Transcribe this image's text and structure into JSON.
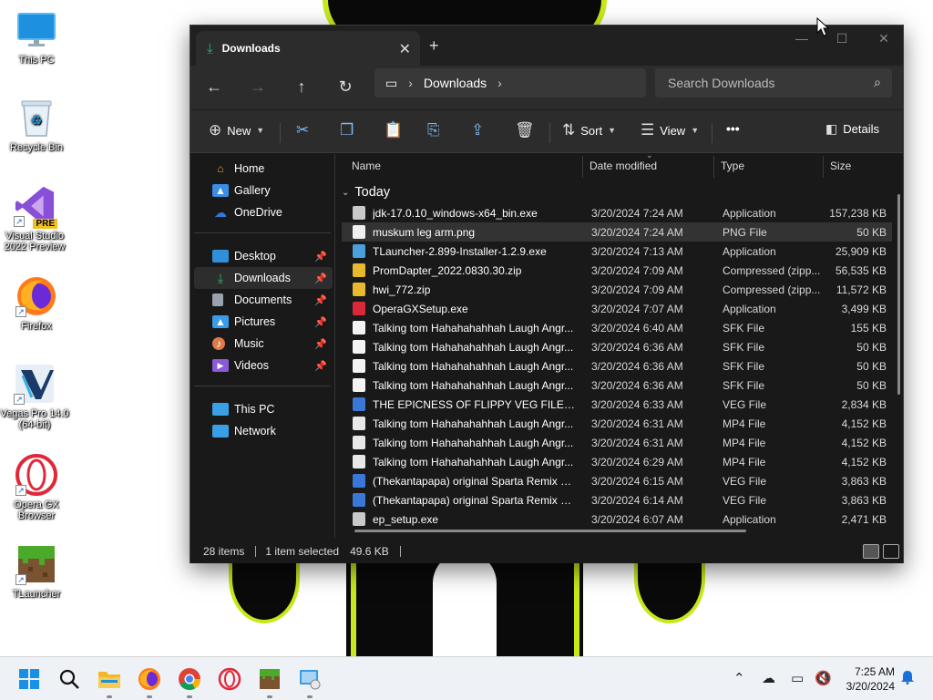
{
  "desktop": {
    "icons": [
      {
        "label": "This PC",
        "icon": "monitor-icon"
      },
      {
        "label": "Recycle Bin",
        "icon": "recycle-bin-icon"
      },
      {
        "label": "Visual Studio 2022 Preview",
        "icon": "visual-studio-icon",
        "badge": "PRE"
      },
      {
        "label": "Firefox",
        "icon": "firefox-icon"
      },
      {
        "label": "Vegas Pro 14.0 (64-bit)",
        "icon": "vegas-pro-icon"
      },
      {
        "label": "Opera GX Browser",
        "icon": "opera-gx-icon"
      },
      {
        "label": "TLauncher",
        "icon": "minecraft-block-icon"
      }
    ]
  },
  "window": {
    "tab_title": "Downloads",
    "new_tab": "+",
    "nav": {
      "address_root": "Downloads",
      "search_placeholder": "Search Downloads"
    },
    "toolbar": {
      "new_label": "New",
      "sort_label": "Sort",
      "view_label": "View",
      "more_label": "•••",
      "details_label": "Details"
    },
    "sidebar": {
      "items": [
        {
          "label": "Home",
          "color": "#e2a63a"
        },
        {
          "label": "Gallery",
          "color": "#3a8ee6"
        },
        {
          "label": "OneDrive",
          "color": "#2f7ad8"
        },
        {
          "label": "Desktop",
          "color": "#2f8fd8",
          "pinned": true
        },
        {
          "label": "Downloads",
          "color": "#2bb673",
          "pinned": true,
          "active": true
        },
        {
          "label": "Documents",
          "color": "#9aa3ad",
          "pinned": true
        },
        {
          "label": "Pictures",
          "color": "#3a9be6",
          "pinned": true
        },
        {
          "label": "Music",
          "color": "#e07a4a",
          "pinned": true
        },
        {
          "label": "Videos",
          "color": "#8a5ad8",
          "pinned": true
        },
        {
          "label": "This PC",
          "color": "#3aa0e6"
        },
        {
          "label": "Network",
          "color": "#3aa0e6"
        }
      ]
    },
    "columns": {
      "name": "Name",
      "date": "Date modified",
      "type": "Type",
      "size": "Size"
    },
    "group": "Today",
    "files": [
      {
        "name": "jdk-17.0.10_windows-x64_bin.exe",
        "date": "3/20/2024 7:24 AM",
        "type": "Application",
        "size": "157,238 KB",
        "icon_color": "#c9c9c9"
      },
      {
        "name": "muskum leg arm.png",
        "date": "3/20/2024 7:24 AM",
        "type": "PNG File",
        "size": "50 KB",
        "icon_color": "#f0f0f0",
        "selected": true
      },
      {
        "name": "TLauncher-2.899-Installer-1.2.9.exe",
        "date": "3/20/2024 7:13 AM",
        "type": "Application",
        "size": "25,909 KB",
        "icon_color": "#4aa0d8"
      },
      {
        "name": "PromDapter_2022.0830.30.zip",
        "date": "3/20/2024 7:09 AM",
        "type": "Compressed (zipp...",
        "size": "56,535 KB",
        "icon_color": "#e8b830"
      },
      {
        "name": "hwi_772.zip",
        "date": "3/20/2024 7:09 AM",
        "type": "Compressed (zipp...",
        "size": "11,572 KB",
        "icon_color": "#e8b830"
      },
      {
        "name": "OperaGXSetup.exe",
        "date": "3/20/2024 7:07 AM",
        "type": "Application",
        "size": "3,499 KB",
        "icon_color": "#d8283a"
      },
      {
        "name": "Talking tom Hahahahahhah Laugh Angr...",
        "date": "3/20/2024 6:40 AM",
        "type": "SFK File",
        "size": "155 KB",
        "icon_color": "#f4f4f4"
      },
      {
        "name": "Talking tom Hahahahahhah Laugh Angr...",
        "date": "3/20/2024 6:36 AM",
        "type": "SFK File",
        "size": "50 KB",
        "icon_color": "#f4f4f4"
      },
      {
        "name": "Talking tom Hahahahahhah Laugh Angr...",
        "date": "3/20/2024 6:36 AM",
        "type": "SFK File",
        "size": "50 KB",
        "icon_color": "#f4f4f4"
      },
      {
        "name": "Talking tom Hahahahahhah Laugh Angr...",
        "date": "3/20/2024 6:36 AM",
        "type": "SFK File",
        "size": "50 KB",
        "icon_color": "#f4f4f4"
      },
      {
        "name": "THE EPICNESS OF FLIPPY VEG FILE.veg",
        "date": "3/20/2024 6:33 AM",
        "type": "VEG File",
        "size": "2,834 KB",
        "icon_color": "#3a78d8"
      },
      {
        "name": "Talking tom Hahahahahhah Laugh Angr...",
        "date": "3/20/2024 6:31 AM",
        "type": "MP4 File",
        "size": "4,152 KB",
        "icon_color": "#e8e8e8"
      },
      {
        "name": "Talking tom Hahahahahhah Laugh Angr...",
        "date": "3/20/2024 6:31 AM",
        "type": "MP4 File",
        "size": "4,152 KB",
        "icon_color": "#e8e8e8"
      },
      {
        "name": "Talking tom Hahahahahhah Laugh Angr...",
        "date": "3/20/2024 6:29 AM",
        "type": "MP4 File",
        "size": "4,152 KB",
        "icon_color": "#e8e8e8"
      },
      {
        "name": "(Thekantapapa) original Sparta Remix Ve...",
        "date": "3/20/2024 6:15 AM",
        "type": "VEG File",
        "size": "3,863 KB",
        "icon_color": "#3a78d8"
      },
      {
        "name": "(Thekantapapa) original Sparta Remix Ve...",
        "date": "3/20/2024 6:14 AM",
        "type": "VEG File",
        "size": "3,863 KB",
        "icon_color": "#3a78d8"
      },
      {
        "name": "ep_setup.exe",
        "date": "3/20/2024 6:07 AM",
        "type": "Application",
        "size": "2,471 KB",
        "icon_color": "#c9c9c9"
      }
    ],
    "status": {
      "items_count": "28 items",
      "selection": "1 item selected",
      "selection_size": "49.6 KB"
    }
  },
  "taskbar": {
    "clock_time": "7:25 AM",
    "clock_date": "3/20/2024"
  }
}
